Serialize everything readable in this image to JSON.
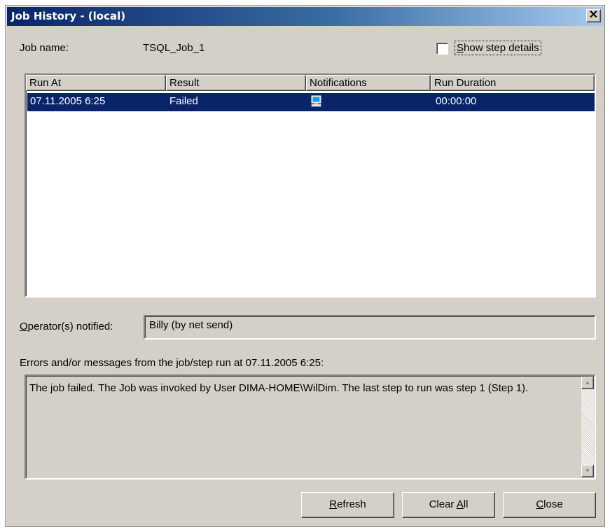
{
  "window": {
    "title": "Job History - (local)",
    "close_glyph": "✕"
  },
  "job": {
    "name_label": "Job name:",
    "name_value": "TSQL_Job_1"
  },
  "show_step_details": {
    "label": "Show step details",
    "checked": false
  },
  "table": {
    "columns": [
      "Run At",
      "Result",
      "Notifications",
      "Run Duration"
    ],
    "rows": [
      {
        "run_at": "07.11.2005  6:25",
        "result": "Failed",
        "notification_icon": "computer-net-send-icon",
        "duration": "00:00:00",
        "selected": true
      }
    ]
  },
  "operators": {
    "label": "Operator(s) notified:",
    "value": "Billy (by net send)"
  },
  "messages": {
    "label": "Errors and/or messages from the job/step run at 07.11.2005  6:25:",
    "text": "The job failed.  The Job was invoked by User DIMA-HOME\\WilDim.  The last step to run was step 1 (Step 1)."
  },
  "buttons": {
    "refresh": "Refresh",
    "clear_all": "Clear All",
    "close": "Close"
  },
  "colors": {
    "titlebar": "#0a246a",
    "selection": "#0a246a",
    "face": "#d4d0c8"
  }
}
